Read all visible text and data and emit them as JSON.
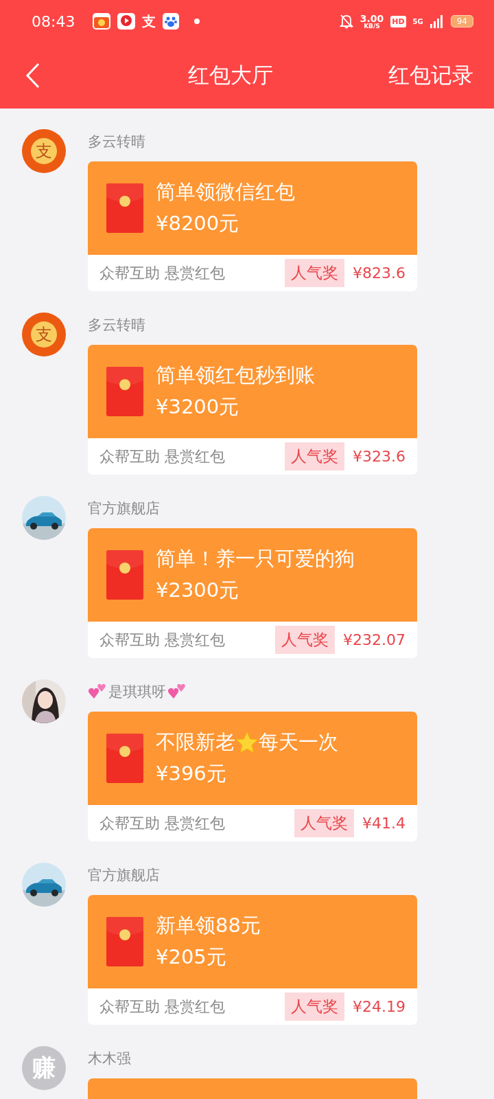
{
  "status_bar": {
    "time": "08:43",
    "apps": [
      {
        "kind": "red-app"
      },
      {
        "kind": "video-app"
      },
      {
        "kind": "glyph",
        "glyph": "支"
      },
      {
        "kind": "paw-app"
      }
    ],
    "speed": "3.00",
    "speed_unit": "KB/S",
    "hd": "HD",
    "network": "5G",
    "battery": "94"
  },
  "header": {
    "title": "红包大厅",
    "action": "红包记录"
  },
  "items": [
    {
      "avatar": {
        "kind": "logo",
        "glyph": "支"
      },
      "name": [
        {
          "kind": "text",
          "text": "多云转晴"
        }
      ],
      "card": {
        "kind": "full",
        "title": [
          {
            "kind": "text",
            "text": "简单领微信红包"
          }
        ],
        "amount": "¥8200元",
        "footer": "众帮互助 悬赏红包",
        "badge": "人气奖",
        "reward": "¥823.6"
      }
    },
    {
      "avatar": {
        "kind": "logo",
        "glyph": "支"
      },
      "name": [
        {
          "kind": "text",
          "text": "多云转晴"
        }
      ],
      "card": {
        "kind": "full",
        "title": [
          {
            "kind": "text",
            "text": "简单领红包秒到账"
          }
        ],
        "amount": "¥3200元",
        "footer": "众帮互助 悬赏红包",
        "badge": "人气奖",
        "reward": "¥323.6"
      }
    },
    {
      "name": [
        {
          "kind": "text",
          "text": "官方旗舰店"
        }
      ],
      "card": {
        "kind": "full",
        "title": [
          {
            "kind": "text",
            "text": "简单！养一只可爱的狗"
          }
        ],
        "amount": "¥2300元",
        "footer": "众帮互助 悬赏红包",
        "badge": "人气奖",
        "reward": "¥232.07"
      }
    },
    {
      "avatar": {
        "kind": "person"
      },
      "name": [
        {
          "kind": "hearts"
        },
        {
          "kind": "text",
          "text": "是琪琪呀"
        },
        {
          "kind": "hearts"
        }
      ],
      "card": {
        "kind": "full",
        "title": [
          {
            "kind": "text",
            "text": "不限新老"
          },
          {
            "kind": "star"
          },
          {
            "kind": "text",
            "text": "每天一次"
          }
        ],
        "amount": "¥396元",
        "footer": "众帮互助 悬赏红包",
        "badge": "人气奖",
        "reward": "¥41.4"
      }
    },
    {
      "name": [
        {
          "kind": "text",
          "text": "官方旗舰店"
        }
      ],
      "card": {
        "kind": "full",
        "title": [
          {
            "kind": "text",
            "text": "新单领88元"
          }
        ],
        "amount": "¥205元",
        "footer": "众帮互助 悬赏红包",
        "badge": "人气奖",
        "reward": "¥24.19"
      }
    },
    {
      "avatar": {
        "kind": "letter",
        "glyph": "赚"
      },
      "name": [
        {
          "kind": "text",
          "text": "木木强"
        }
      ],
      "card": {
        "kind": "cut"
      }
    }
  ]
}
